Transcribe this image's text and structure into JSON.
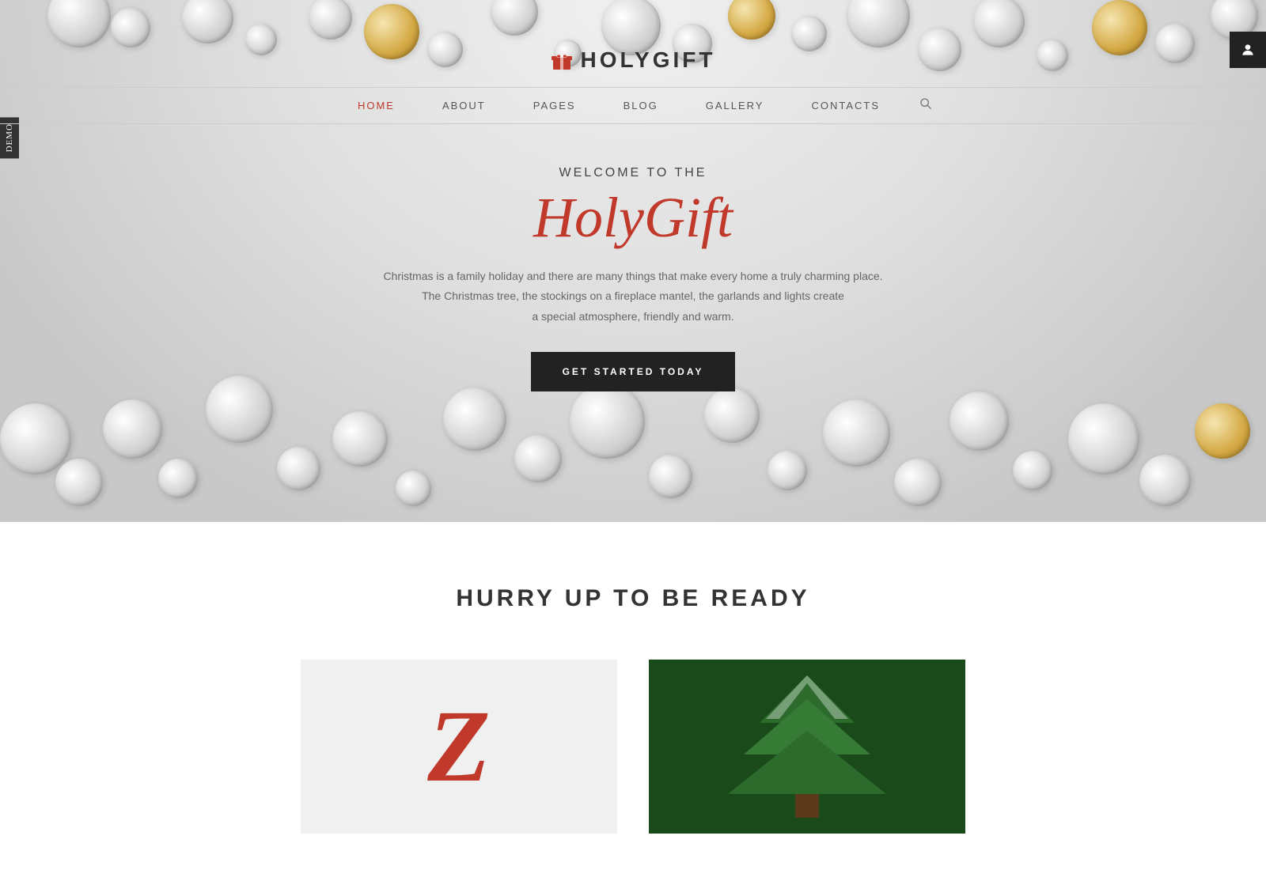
{
  "site": {
    "logo_text": "HOLYGIFT",
    "logo_icon_label": "gift-box-icon"
  },
  "nav": {
    "items": [
      {
        "label": "HOME",
        "active": true
      },
      {
        "label": "ABOUT",
        "active": false
      },
      {
        "label": "PAGES",
        "active": false
      },
      {
        "label": "BLOG",
        "active": false
      },
      {
        "label": "GALLERY",
        "active": false
      },
      {
        "label": "CONTACTS",
        "active": false
      }
    ],
    "search_label": "🔍"
  },
  "hero": {
    "welcome_line": "WELCOME TO THE",
    "brand_script": "HolyGift",
    "description_line1": "Christmas is a family holiday and there are many things that make every home a truly charming place.",
    "description_line2": "The Christmas tree, the stockings on a fireplace mantel, the garlands and lights create",
    "description_line3": "a special atmosphere, friendly and warm.",
    "cta_label": "GET STARTED TODAY"
  },
  "below_fold": {
    "section_title": "HURRY UP TO BE READY"
  },
  "side_tag": {
    "label": "DEMO"
  },
  "user_icon": "👤",
  "colors": {
    "accent_red": "#c0392b",
    "dark": "#222222",
    "text_gray": "#666666",
    "nav_line": "#cccccc"
  }
}
